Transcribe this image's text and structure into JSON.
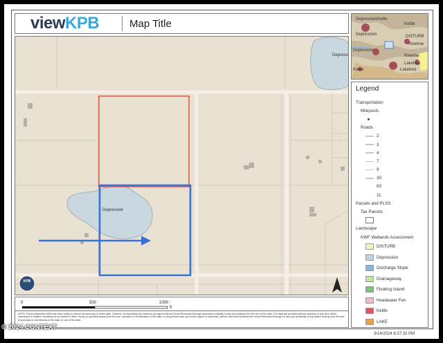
{
  "header": {
    "logo_view": "view",
    "logo_kpb": "KPB",
    "title": "Map Title"
  },
  "map": {
    "feature_label": "Depression",
    "badge_text": "KPB"
  },
  "scalebar": {
    "ticks": [
      "0",
      "500",
      "1000"
    ],
    "unit": "ft"
  },
  "note": "NOTE: Every reasonable effort has been made to ensure the accuracy of these data. However, by accepting this material, you agree that the Kenai Peninsula Borough assumes no liability of any kind arising from the use of this data. The data are provided without warranty of any kind, either expressed or implied, including but not limited to time, money or goodwill arising from the use, operation or modification of the data. In using these data, you further agree to indemnify, defend, and hold harmless the Kenai Peninsula Borough for any and all liability of any nature arising from the lack of accuracy or correctness of the data, or use of the data.",
  "inset": {
    "labels": [
      "DepressionKettle",
      "Kettle",
      "Depression",
      "DISTURB",
      "Riverine",
      "Depression",
      "Riverine",
      "Lakebed",
      "Lakebed",
      "Kettle"
    ]
  },
  "legend": {
    "title": "Legend",
    "transportation": "Transportation",
    "mileposts": "Mileposts",
    "roads": "Roads",
    "road_classes": [
      "2",
      "3",
      "4",
      "7",
      "9",
      "30",
      "83",
      "11"
    ],
    "parcels_plss": "Parcels and PLSS",
    "tax_parcels": "Tax Parcels",
    "landscape": "Landscape",
    "kwf": "KWF Wetlands Assessment",
    "wetlands": [
      {
        "label": "DISTURB",
        "color": "#f7f3b8"
      },
      {
        "label": "Depression",
        "color": "#bfd3e6"
      },
      {
        "label": "Discharge Slope",
        "color": "#8fb3d9"
      },
      {
        "label": "Drainageway",
        "color": "#c6e2a8"
      },
      {
        "label": "Floating Island",
        "color": "#7cc27a"
      },
      {
        "label": "Headwater Fen",
        "color": "#f3bcbc"
      },
      {
        "label": "Kettle",
        "color": "#d9585e"
      },
      {
        "label": "LAKE",
        "color": "#e8a24a"
      }
    ]
  },
  "date_stamp": "3/14/2024 6:37:32 PM",
  "copyright": "© 2024 CONTEXT",
  "colors": {
    "map_bg": "#e9e2d2",
    "water": "#c9d7df",
    "parcel_outline": "#e23b2e",
    "highlight_outline": "#3a6fd8",
    "arrow": "#3a6fd8"
  }
}
